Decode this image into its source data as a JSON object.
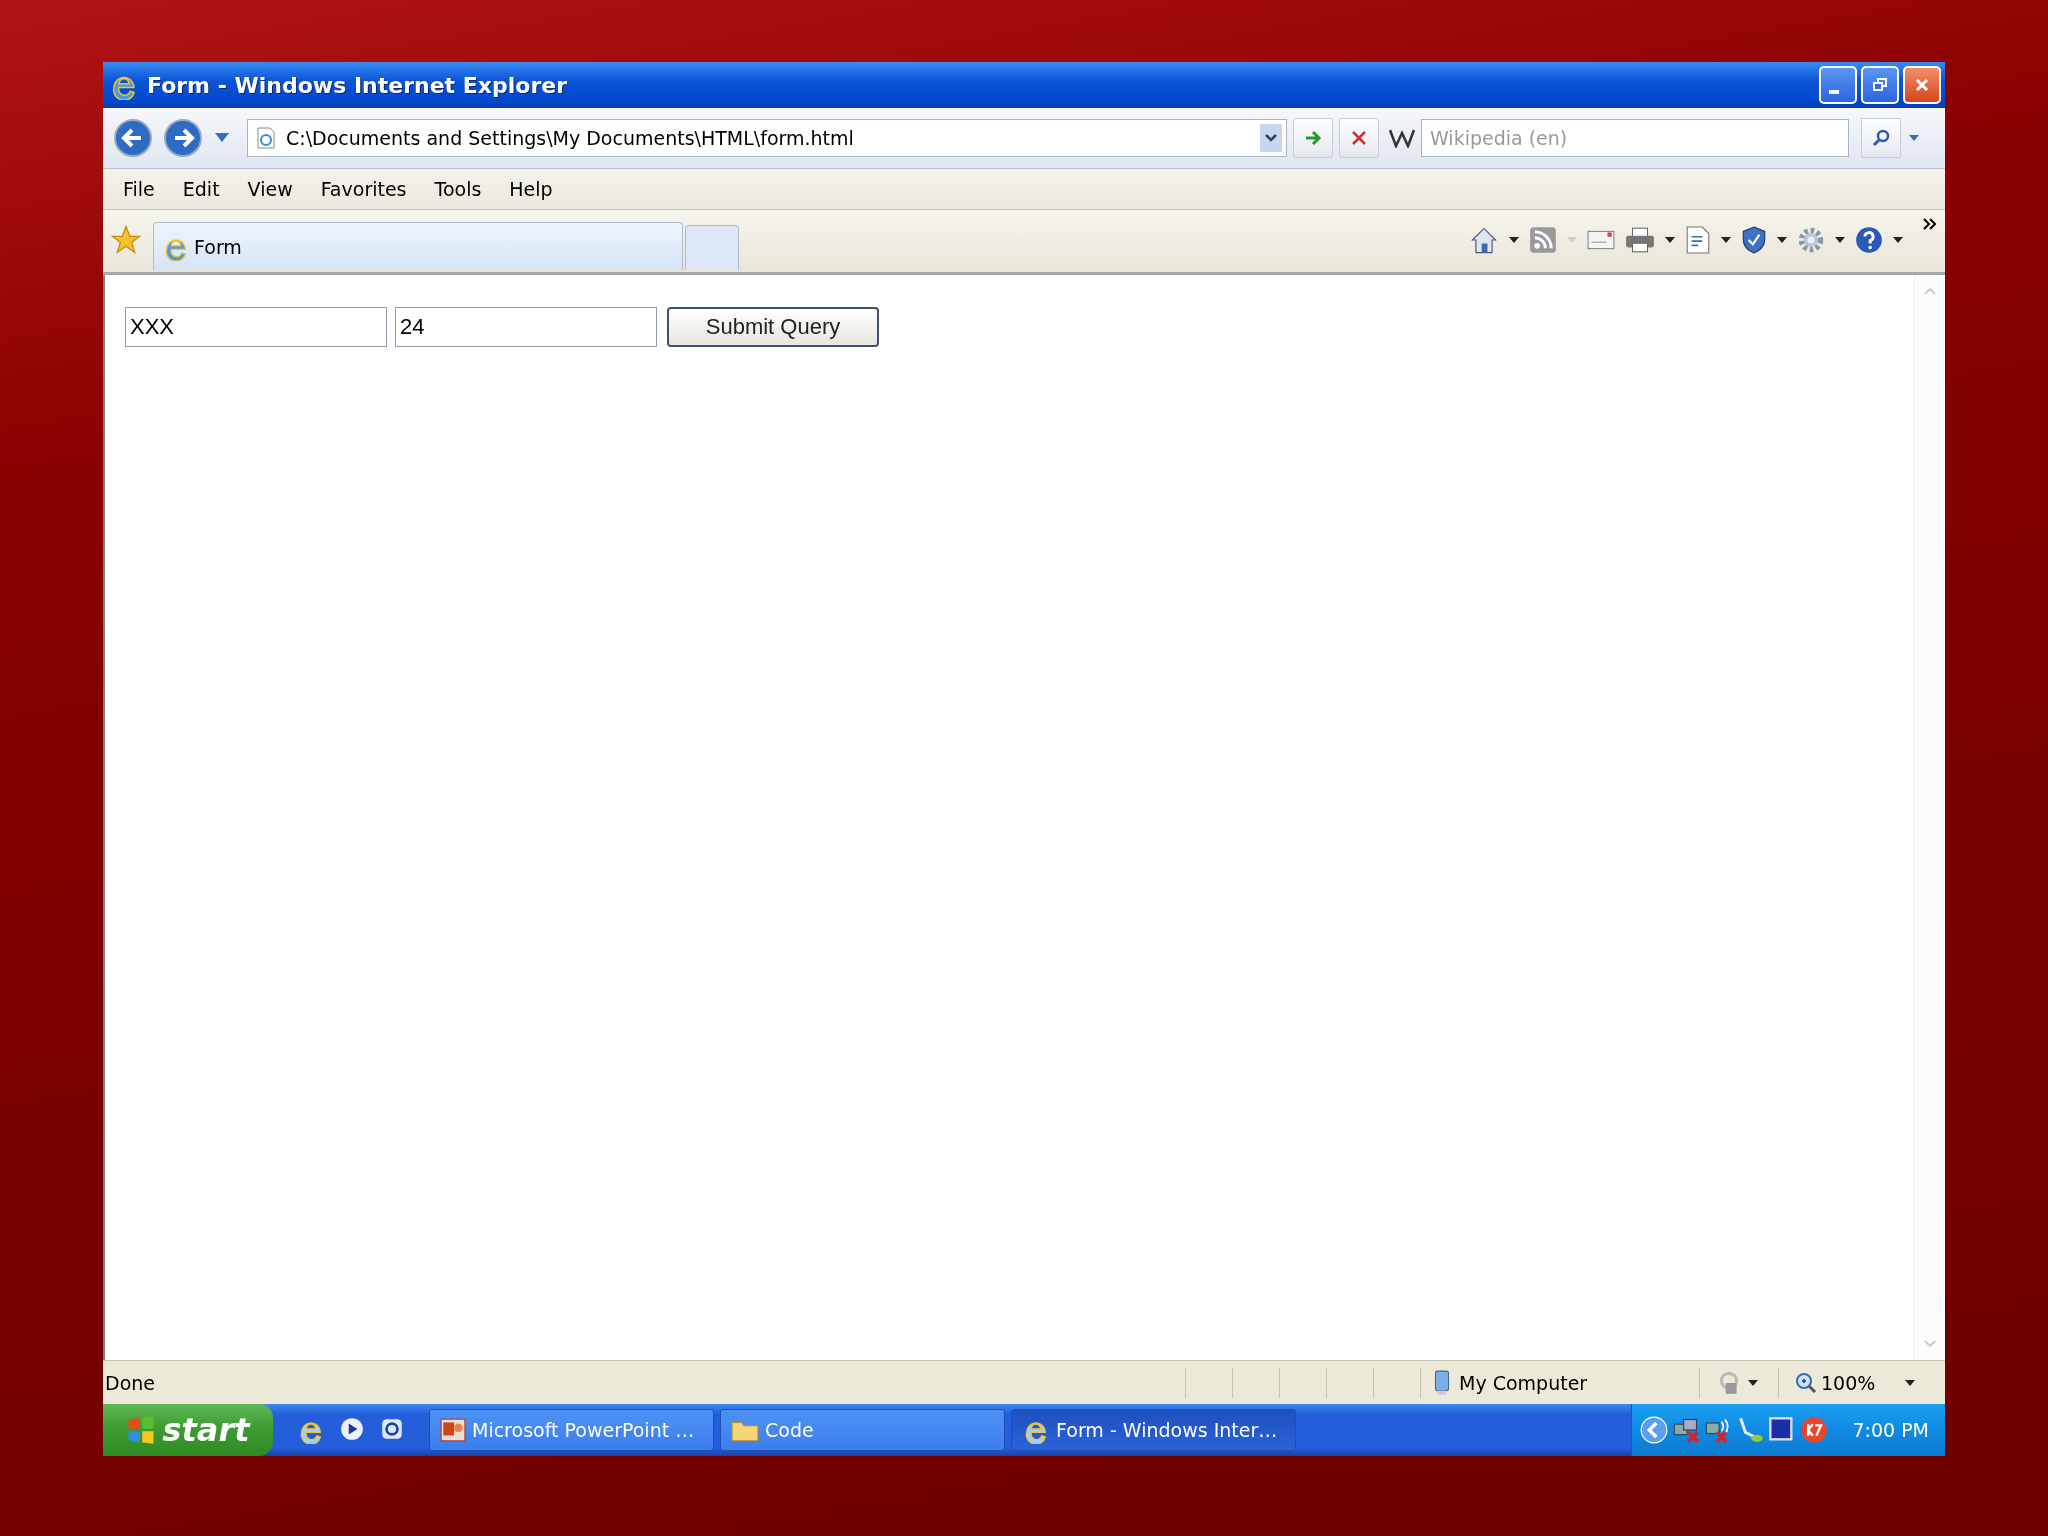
{
  "window": {
    "title": "Form - Windows Internet Explorer"
  },
  "address_bar": {
    "value": "C:\\Documents and Settings\\My Documents\\HTML\\form.html"
  },
  "search": {
    "placeholder": "Wikipedia (en)"
  },
  "menu": [
    "File",
    "Edit",
    "View",
    "Favorites",
    "Tools",
    "Help"
  ],
  "tabs": [
    {
      "label": "Form",
      "selected": true
    }
  ],
  "form": {
    "fields": [
      {
        "value": "XXX"
      },
      {
        "value": "24"
      }
    ],
    "button": "Submit Query"
  },
  "status_bar": {
    "text": "Done",
    "zone": "My Computer",
    "zoom": "100%"
  },
  "taskbar": {
    "start": "start",
    "items": [
      {
        "label": "Microsoft PowerPoint …",
        "kind": "powerpoint",
        "selected": false
      },
      {
        "label": "Code",
        "kind": "folder",
        "selected": false
      },
      {
        "label": "Form - Windows Inter…",
        "kind": "browser",
        "selected": true
      }
    ],
    "clock": "7:00 PM"
  }
}
